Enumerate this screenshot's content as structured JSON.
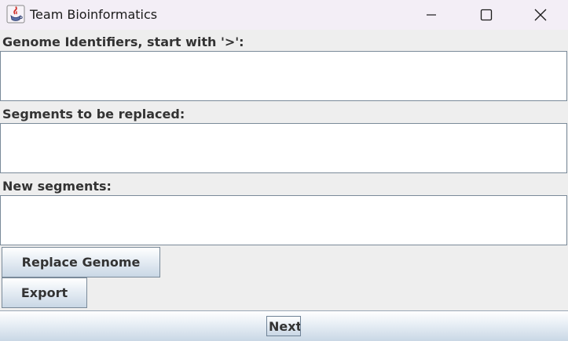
{
  "window": {
    "title": "Team Bioinformatics",
    "app_icon": "java-cup-icon",
    "controls": {
      "minimize": "minimize-icon",
      "maximize": "maximize-icon",
      "close": "close-icon"
    }
  },
  "form": {
    "genome_label": "Genome Identifiers, start with '>':",
    "genome_value": "",
    "segments_label": "Segments to be replaced:",
    "segments_value": "",
    "new_segments_label": "New segments:",
    "new_segments_value": ""
  },
  "actions": {
    "replace_label": "Replace Genome",
    "export_label": "Export",
    "next_label": "Next"
  },
  "colors": {
    "titlebar": "#f3eef6",
    "background": "#eeeeee",
    "border": "#7a8a99",
    "label_text": "#333333"
  }
}
